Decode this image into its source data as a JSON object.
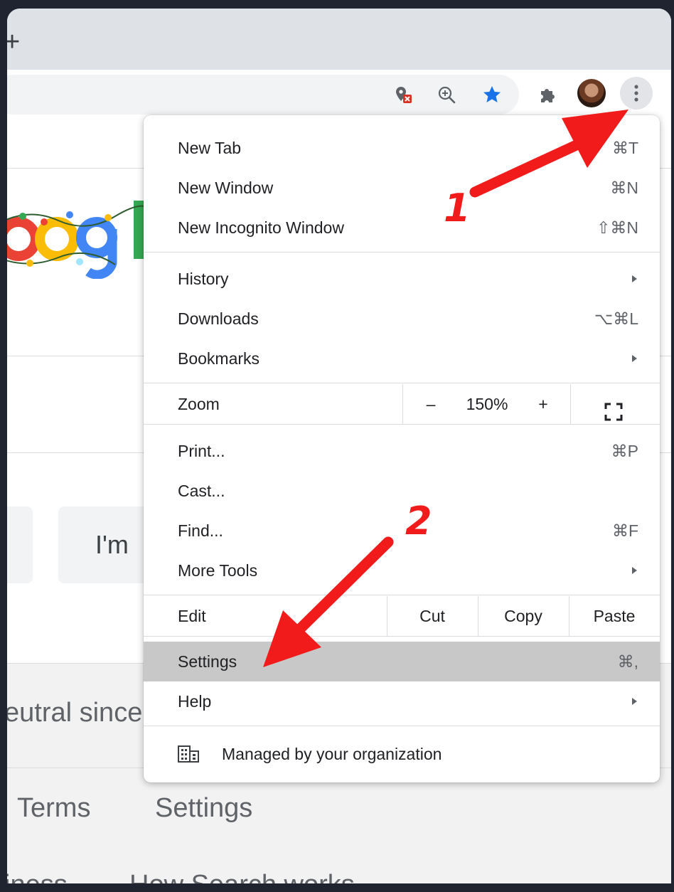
{
  "browser": {
    "new_tab_glyph": "+",
    "toolbar_icons": [
      "extension-blocked-icon",
      "zoom-icon",
      "bookmark-star-icon",
      "extensions-puzzle-icon",
      "profile-avatar",
      "kebab-menu-icon"
    ],
    "accent_color": "#1a73e8"
  },
  "page": {
    "lucky_button_label": "I'm",
    "carbon_text": "eutral since",
    "footer": {
      "terms": "Terms",
      "settings": "Settings",
      "business": "iness",
      "how_search_works": "How Search works"
    }
  },
  "menu": {
    "new_tab": {
      "label": "New Tab",
      "shortcut": "⌘T"
    },
    "new_window": {
      "label": "New Window",
      "shortcut": "⌘N"
    },
    "new_incognito": {
      "label": "New Incognito Window",
      "shortcut": "⇧⌘N"
    },
    "history": {
      "label": "History"
    },
    "downloads": {
      "label": "Downloads",
      "shortcut": "⌥⌘L"
    },
    "bookmarks": {
      "label": "Bookmarks"
    },
    "zoom": {
      "label": "Zoom",
      "minus": "–",
      "level": "150%",
      "plus": "+"
    },
    "print": {
      "label": "Print...",
      "shortcut": "⌘P"
    },
    "cast": {
      "label": "Cast..."
    },
    "find": {
      "label": "Find...",
      "shortcut": "⌘F"
    },
    "more_tools": {
      "label": "More Tools"
    },
    "edit": {
      "label": "Edit",
      "cut": "Cut",
      "copy": "Copy",
      "paste": "Paste"
    },
    "settings": {
      "label": "Settings",
      "shortcut": "⌘,"
    },
    "help": {
      "label": "Help"
    },
    "managed": {
      "label": "Managed by your organization"
    },
    "highlight_color": "#c8c8c8"
  },
  "annotations": {
    "step1": "1",
    "step2": "2",
    "arrow_color": "#f21b1b"
  }
}
